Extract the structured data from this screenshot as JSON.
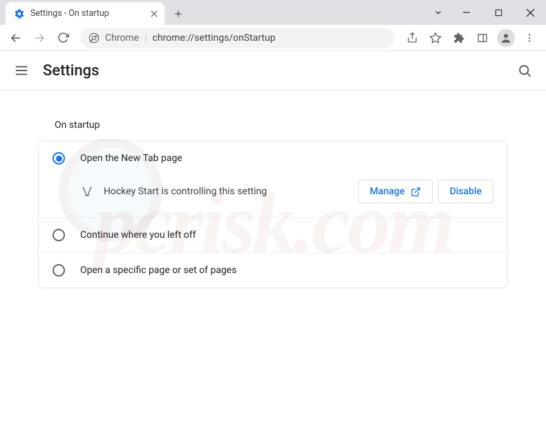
{
  "window": {
    "tab_title": "Settings - On startup"
  },
  "omnibox": {
    "scheme_label": "Chrome",
    "url_path": "chrome://settings/onStartup"
  },
  "header": {
    "title": "Settings"
  },
  "section": {
    "title": "On startup"
  },
  "options": {
    "new_tab": "Open the New Tab page",
    "continue": "Continue where you left off",
    "specific": "Open a specific page or set of pages"
  },
  "extension_notice": {
    "text": "Hockey Start is controlling this setting",
    "manage_label": "Manage",
    "disable_label": "Disable"
  }
}
